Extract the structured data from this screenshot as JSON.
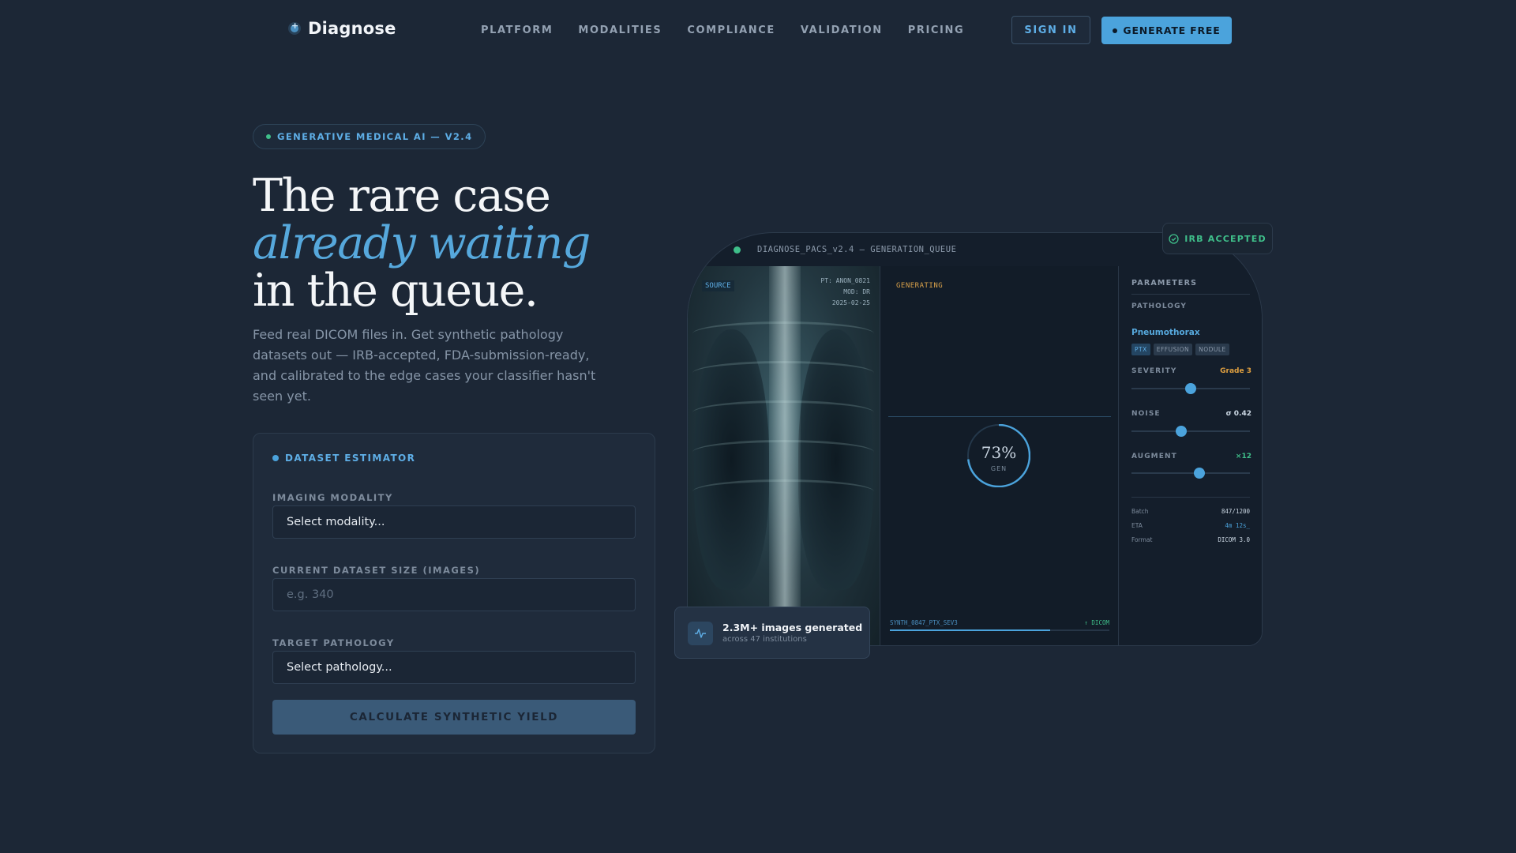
{
  "brand": {
    "name": "Diagnose"
  },
  "nav": {
    "items": [
      "PLATFORM",
      "MODALITIES",
      "COMPLIANCE",
      "VALIDATION",
      "PRICING"
    ]
  },
  "header": {
    "sign_in": "SIGN IN",
    "generate_free": "GENERATE FREE"
  },
  "hero": {
    "badge": "GENERATIVE MEDICAL AI — V2.4",
    "line1": "The rare case",
    "line2": "already waiting",
    "line3": "in the queue.",
    "lead": "Feed real DICOM files in. Get synthetic pathology datasets out — IRB-accepted, FDA-submission-ready, and calibrated to the edge cases your classifier hasn't seen yet."
  },
  "estimator": {
    "title": "DATASET ESTIMATOR",
    "modality_label": "IMAGING MODALITY",
    "modality_value": "Select modality...",
    "size_label": "CURRENT DATASET SIZE (IMAGES)",
    "size_placeholder": "e.g. 340",
    "pathology_label": "TARGET PATHOLOGY",
    "pathology_value": "Select pathology...",
    "button": "CALCULATE SYNTHETIC YIELD"
  },
  "device": {
    "title": "DIAGNOSE_PACS_v2.4 — GENERATION_QUEUE",
    "source_label": "SOURCE",
    "source_meta": [
      "PT: ANON_0821",
      "MOD: DR",
      "2025-02-25"
    ],
    "generating_label": "GENERATING",
    "progress": 0.73,
    "progress_text": "73%",
    "progress_caption": "GEN",
    "file_name": "SYNTH_0847_PTX_SEV3",
    "file_format": "↑ DICOM",
    "params": {
      "title": "PARAMETERS",
      "pathology_label": "PATHOLOGY",
      "pathology_value": "Pneumothorax",
      "chips": [
        "PTX",
        "EFFUSION",
        "NODULE"
      ],
      "severity_label": "SEVERITY",
      "severity_value": "Grade 3",
      "severity_level": 0.5,
      "noise_label": "NOISE",
      "noise_value": "σ 0.42",
      "noise_level": 0.42,
      "augment_label": "AUGMENT",
      "augment_value": "×12",
      "augment_level": 0.57,
      "batch_label": "Batch",
      "batch_value": "847/1200",
      "eta_label": "ETA",
      "eta_value": "4m 12s_",
      "format_label": "Format",
      "format_value": "DICOM 3.0"
    }
  },
  "irb": {
    "label": "IRB ACCEPTED"
  },
  "stat": {
    "headline": "2.3M+ images generated",
    "sub": "across 47 institutions"
  },
  "colors": {
    "accent": "#4ba3dc",
    "success": "#3fbf8a",
    "warning": "#d9a14a",
    "background": "#1c2736"
  }
}
